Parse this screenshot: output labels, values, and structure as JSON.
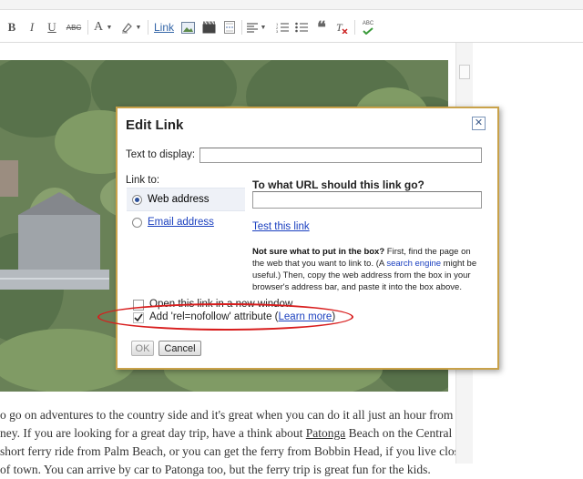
{
  "toolbar": {
    "bold_label": "B",
    "italic_label": "I",
    "underline_label": "U",
    "strike_label": "ABC",
    "font_color_label": "A",
    "link_label": "Link",
    "spell_label": "ABC"
  },
  "body_text": {
    "line1": "o go on adventures to the country side and it's great when you can do it all just an hour from",
    "line2_a": "ney.  If you are looking for a great day trip, have a think about ",
    "line2_link": "Patonga",
    "line2_b": " Beach on the Central",
    "line3": "short ferry ride from Palm Beach, or you can get the ferry from Bobbin Head,  if you live closer",
    "line4": "of town.  You can arrive by car to Patonga too, but the ferry trip is great fun for the kids."
  },
  "dialog": {
    "title": "Edit Link",
    "close_glyph": "✕",
    "text_to_display_label": "Text to display:",
    "text_to_display_value": "",
    "link_to_label": "Link to:",
    "option_web": "Web address",
    "option_email": "Email address",
    "selected_option": "Web address",
    "url_question": "To what URL should this link go?",
    "url_value": "",
    "test_link": "Test this link",
    "help_bold": "Not sure what to put in the box?",
    "help_1": " First, find the page on the web that you want to link to. (A ",
    "help_link": "search engine",
    "help_2": " might be useful.) Then, copy the web address from the box in your browser's address bar, and paste it into the box above.",
    "new_window_label": "Open this link in a new window",
    "new_window_checked": false,
    "nofollow_label": "Add 'rel=nofollow' attribute (",
    "nofollow_link": "Learn more",
    "nofollow_close": ")",
    "nofollow_checked": true,
    "ok_label": "OK",
    "cancel_label": "Cancel"
  },
  "colors": {
    "dialog_border": "#c9a24a",
    "annotation_ellipse": "#d81d1d",
    "link_blue": "#1a3fbf"
  }
}
